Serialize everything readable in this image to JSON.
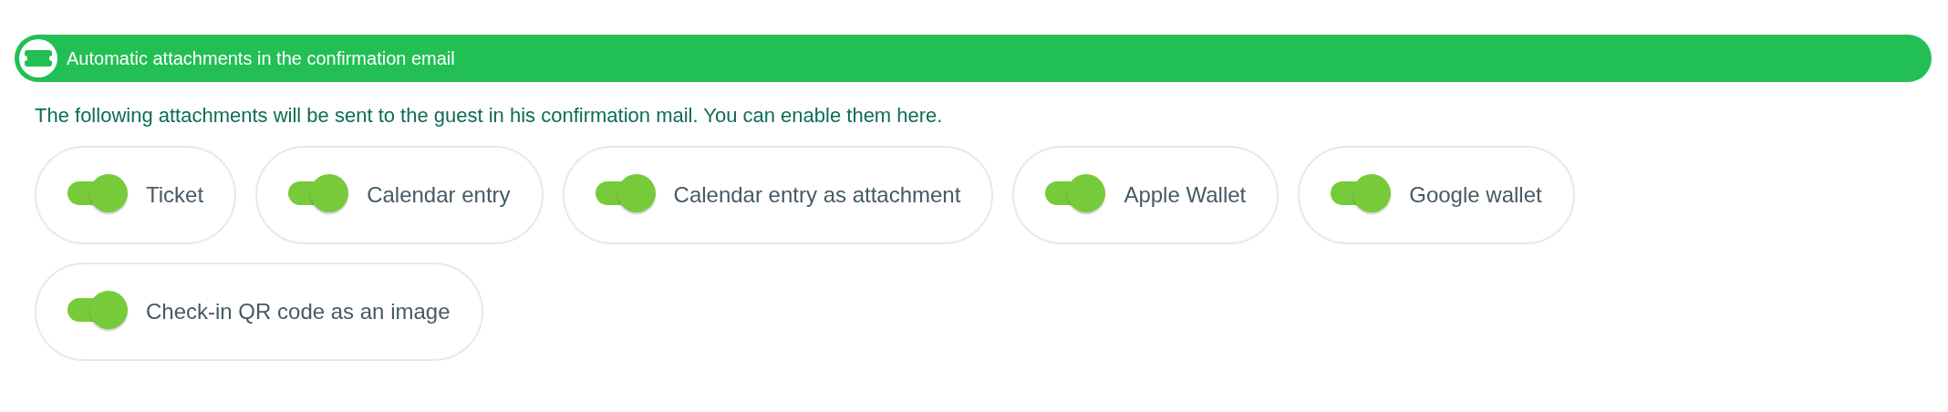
{
  "header": {
    "title": "Automatic attachments in the confirmation email"
  },
  "description": "The following attachments will be sent to the guest in his confirmation mail. You can enable them here.",
  "attachments": [
    {
      "label": "Ticket",
      "on": true
    },
    {
      "label": "Calendar entry",
      "on": true
    },
    {
      "label": "Calendar entry as attachment",
      "on": true
    },
    {
      "label": "Apple Wallet",
      "on": true
    },
    {
      "label": "Google wallet",
      "on": true
    },
    {
      "label": "Check-in QR code as an image",
      "on": true
    }
  ]
}
